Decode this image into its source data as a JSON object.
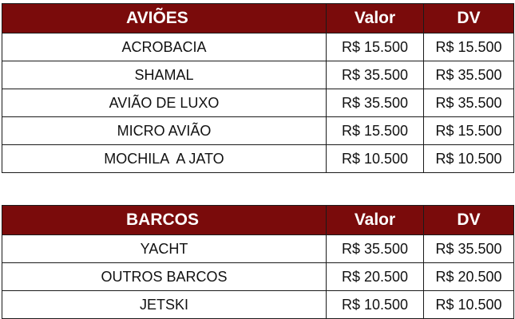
{
  "sections": [
    {
      "title": "AVIÕES",
      "col_valor": "Valor",
      "col_dv": "DV",
      "rows": [
        {
          "name": "ACROBACIA",
          "valor": "R$ 15.500",
          "dv": "R$ 15.500"
        },
        {
          "name": "SHAMAL",
          "valor": "R$ 35.500",
          "dv": "R$ 35.500"
        },
        {
          "name": "AVIÃO DE LUXO",
          "valor": "R$ 35.500",
          "dv": "R$ 35.500"
        },
        {
          "name": "MICRO AVIÃO",
          "valor": "R$ 15.500",
          "dv": "R$ 15.500"
        },
        {
          "name": "MOCHILA  A JATO",
          "valor": "R$ 10.500",
          "dv": "R$ 10.500"
        }
      ]
    },
    {
      "title": "BARCOS",
      "col_valor": "Valor",
      "col_dv": "DV",
      "rows": [
        {
          "name": "YACHT",
          "valor": "R$ 35.500",
          "dv": "R$ 35.500"
        },
        {
          "name": "OUTROS BARCOS",
          "valor": "R$ 20.500",
          "dv": "R$ 20.500"
        },
        {
          "name": "JETSKI",
          "valor": "R$ 10.500",
          "dv": "R$ 10.500"
        }
      ]
    }
  ],
  "colors": {
    "header_background": "#7a0b0b",
    "header_text": "#ffffff",
    "border": "#1a1a1a"
  }
}
